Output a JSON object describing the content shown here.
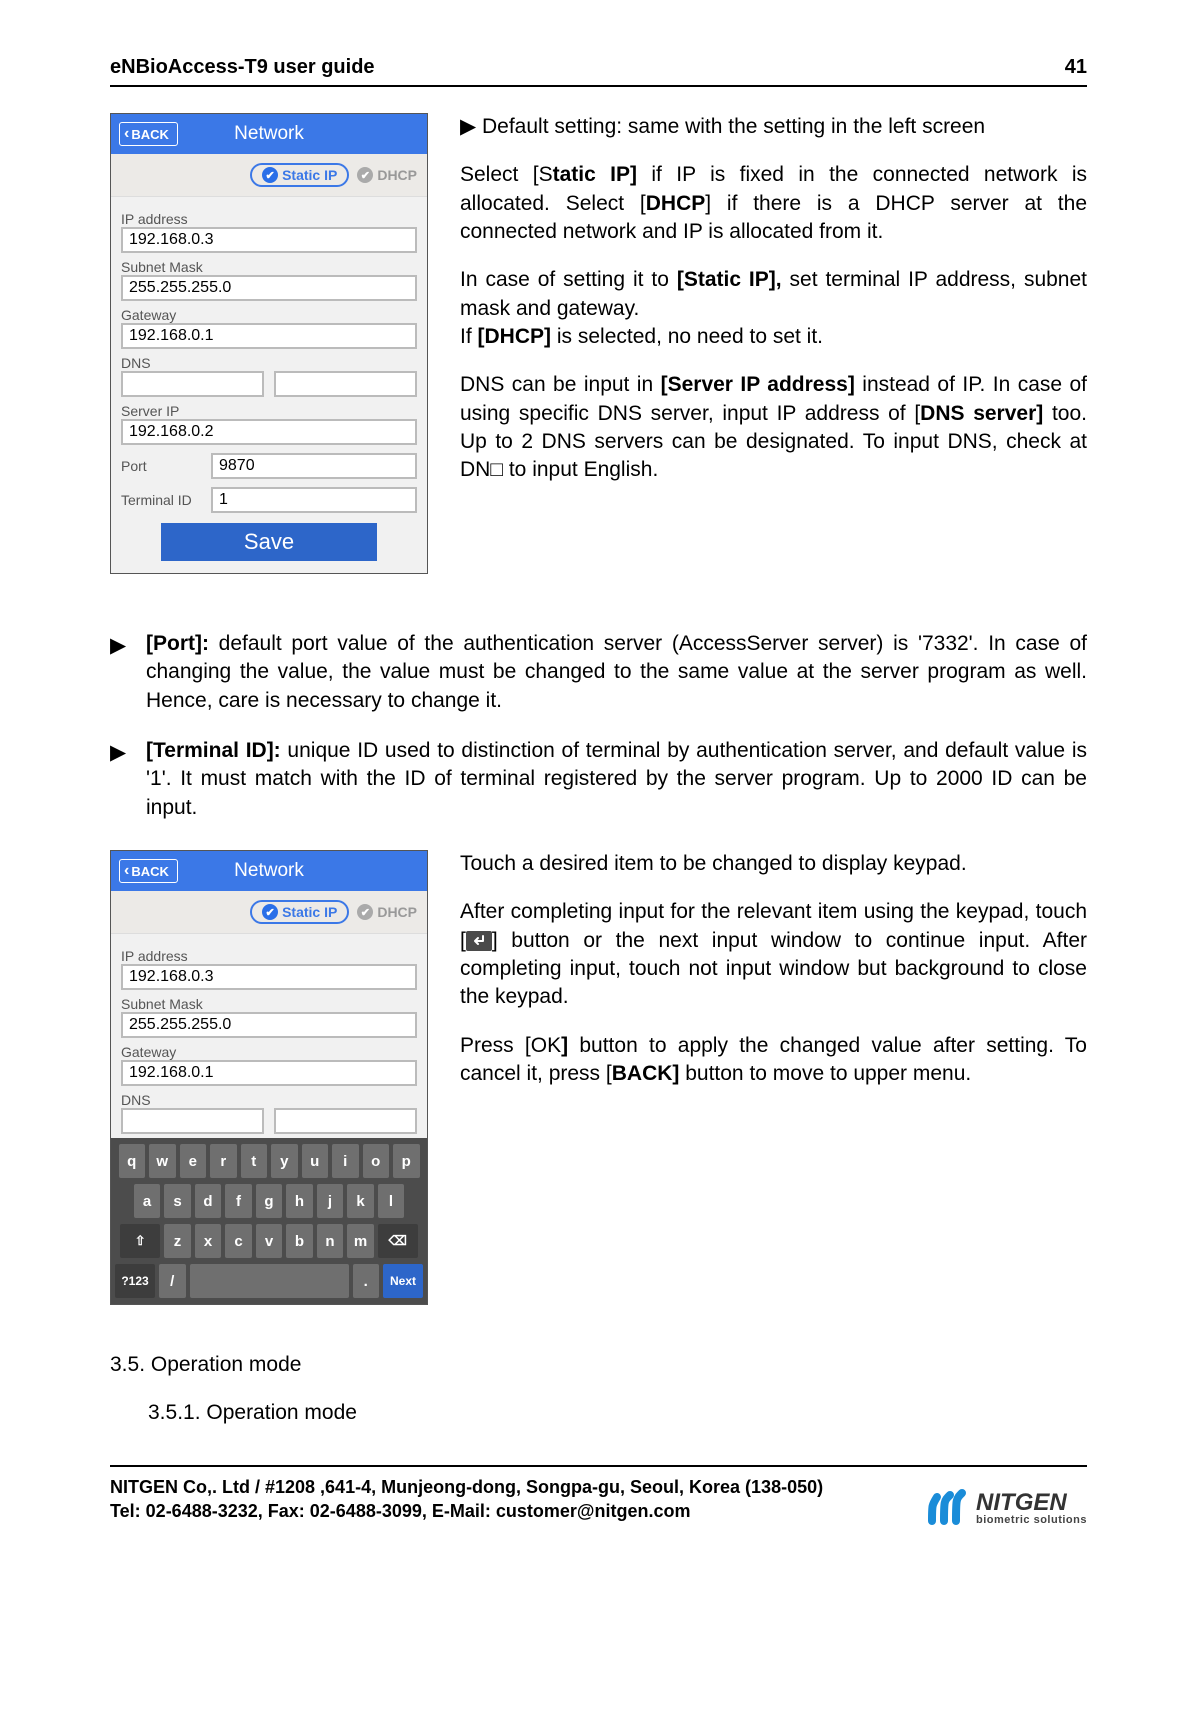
{
  "header": {
    "title": "eNBioAccess-T9 user guide",
    "page_no": "41"
  },
  "device1": {
    "back": "BACK",
    "title": "Network",
    "static_ip": "Static IP",
    "dhcp": "DHCP",
    "fields": {
      "ip_label": "IP address",
      "ip_value": "192.168.0.3",
      "mask_label": "Subnet Mask",
      "mask_value": "255.255.255.0",
      "gw_label": "Gateway",
      "gw_value": "192.168.0.1",
      "dns_label": "DNS",
      "srv_label": "Server IP",
      "srv_value": "192.168.0.2",
      "port_label": "Port",
      "port_value": "9870",
      "tid_label": "Terminal ID",
      "tid_value": "1"
    },
    "save": "Save"
  },
  "right1": {
    "p1": "Default setting: same with the setting in the left screen",
    "p2a": "Select [S",
    "p2b": "tatic IP]",
    "p2c": " if IP is fixed in the connected network is allocated. Select [",
    "p2d": "DHCP",
    "p2e": "] if there is a DHCP server at the connected network and IP is allocated from it.",
    "p3a": "In case of setting it to ",
    "p3b": "[Static IP],",
    "p3c": " set terminal IP address, subnet mask and gateway.",
    "p4a": "If ",
    "p4b": "[DHCP]",
    "p4c": " is selected, no need to set it.",
    "p5a": "DNS can be input in ",
    "p5b": "[Server IP address]",
    "p5c": " instead of IP. In case of using specific DNS server, input IP address of [",
    "p5d": "DNS server]",
    "p5e": " too. Up to 2 DNS servers can be designated. To input DNS, check at DN□ to input English."
  },
  "bullets": {
    "port_lbl": "[Port]:",
    "port_txt": " default port value of the authentication server (AccessServer server) is '7332'. In case of changing the value, the value must be changed to the same value at the server program as well. Hence, care is necessary to change it.",
    "tid_lbl": "[Terminal ID]:",
    "tid_txt": " unique ID used to distinction of terminal by authentication server, and default value is '1'. It must match with the ID of terminal registered by the server program. Up to 2000 ID can be input."
  },
  "device2": {
    "back": "BACK",
    "title": "Network",
    "static_ip": "Static IP",
    "dhcp": "DHCP",
    "fields": {
      "ip_label": "IP address",
      "ip_value": "192.168.0.3",
      "mask_label": "Subnet Mask",
      "mask_value": "255.255.255.0",
      "gw_label": "Gateway",
      "gw_value": "192.168.0.1",
      "dns_label": "DNS"
    },
    "kb": {
      "r1": [
        "q",
        "w",
        "e",
        "r",
        "t",
        "y",
        "u",
        "i",
        "o",
        "p"
      ],
      "r2": [
        "a",
        "s",
        "d",
        "f",
        "g",
        "h",
        "j",
        "k",
        "l"
      ],
      "r3_mid": [
        "z",
        "x",
        "c",
        "v",
        "b",
        "n",
        "m"
      ],
      "sym": "?123",
      "slash": "/",
      "dot": ".",
      "next": "Next"
    }
  },
  "right2": {
    "p1": "Touch a desired item to be changed to display keypad.",
    "p2a": "After completing input for the relevant item using the keypad, touch [",
    "p2b": "] button or the next input window to continue input. After completing input, touch not input window but background to close the keypad.",
    "p3a": "Press [OK",
    "p3b": "]",
    "p3c": " button to apply the changed value after setting. To cancel it, press [",
    "p3d": "BACK]",
    "p3e": " button to move to upper menu."
  },
  "sections": {
    "s35": "3.5. Operation mode",
    "s351": "3.5.1. Operation mode"
  },
  "footer": {
    "line1": "NITGEN Co,. Ltd / #1208 ,641-4, Munjeong-dong, Songpa-gu, Seoul, Korea (138-050)",
    "line2": "Tel: 02-6488-3232, Fax: 02-6488-3099, E-Mail: customer@nitgen.com",
    "logo_big": "NITGEN",
    "logo_small": "biometric solutions"
  }
}
